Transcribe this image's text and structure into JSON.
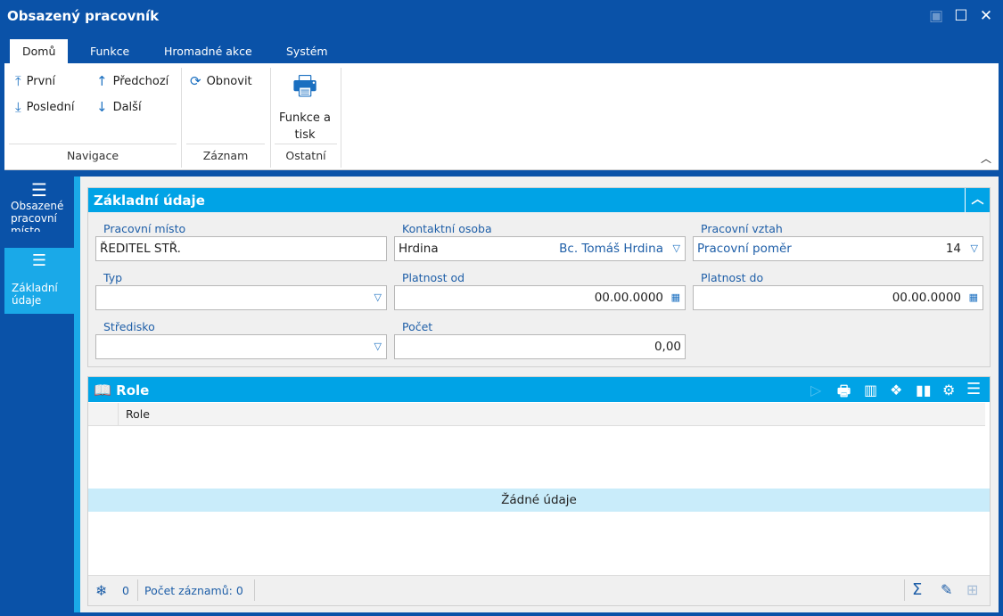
{
  "window": {
    "title": "Obsazený pracovník"
  },
  "tabs": [
    "Domů",
    "Funkce",
    "Hromadné akce",
    "Systém"
  ],
  "ribbon": {
    "first": "První",
    "prev": "Předchozí",
    "last": "Poslední",
    "next": "Další",
    "refresh": "Obnovit",
    "print_line1": "Funkce a",
    "print_line2": "tisk",
    "groups": [
      "Navigace",
      "Záznam",
      "Ostatní"
    ]
  },
  "sidebar": {
    "items": [
      {
        "line1": "Obsazené",
        "line2": "pracovní",
        "line3": "místo"
      },
      {
        "line1": "Základní",
        "line2": "údaje"
      }
    ]
  },
  "basic": {
    "title": "Základní údaje",
    "fields": {
      "workplace_label": "Pracovní místo",
      "workplace": "ŘEDITEL STŘ.",
      "contact_label": "Kontaktní osoba",
      "contact": "Hrdina",
      "contact_name": "Bc. Tomáš Hrdina",
      "relation_label": "Pracovní vztah",
      "relation": "Pracovní poměr",
      "relation_code": "14",
      "type_label": "Typ",
      "type": "",
      "valid_from_label": "Platnost od",
      "valid_from": "00.00.0000",
      "valid_to_label": "Platnost do",
      "valid_to": "00.00.0000",
      "center_label": "Středisko",
      "center": "",
      "count_label": "Počet",
      "count": "0,00"
    }
  },
  "role": {
    "title": "Role",
    "column": "Role",
    "empty": "Žádné údaje",
    "footer_count": "0",
    "footer_records": "Počet záznamů: 0"
  }
}
